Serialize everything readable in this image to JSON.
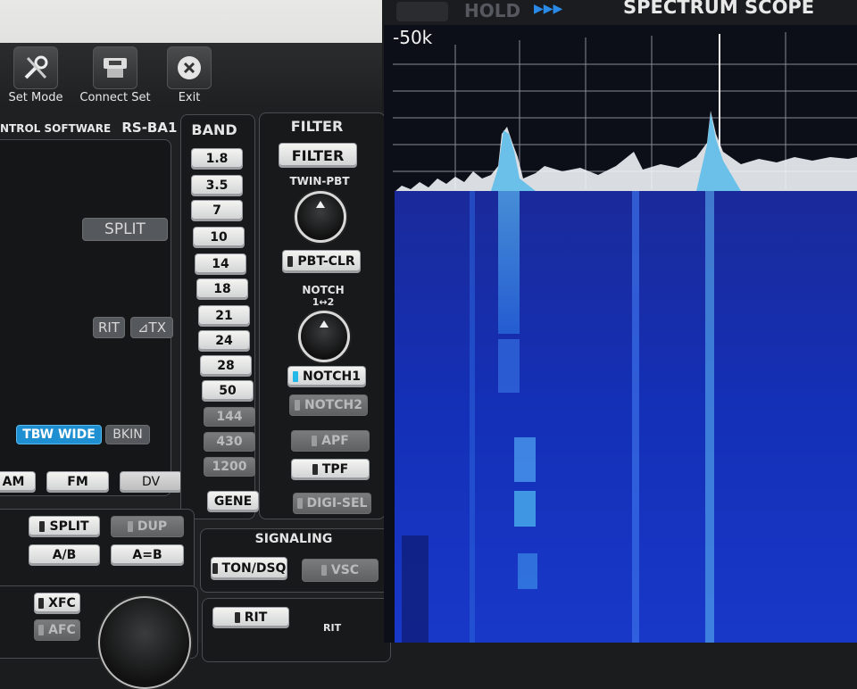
{
  "toolbar": {
    "set_mode": "Set Mode",
    "connect_set": "Connect Set",
    "exit": "Exit"
  },
  "app": {
    "title_left": "NTROL SOFTWARE",
    "title_right": "RS-BA1"
  },
  "display": {
    "split": "SPLIT",
    "rit": "RIT",
    "dtx": "⊿TX",
    "tbw_wide": "TBW WIDE",
    "bkin": "BKIN"
  },
  "modes": [
    "AM",
    "FM",
    "DV"
  ],
  "band": {
    "title": "BAND",
    "items": [
      "1.8",
      "3.5",
      "7",
      "10",
      "14",
      "18",
      "21",
      "24",
      "28",
      "50",
      "144",
      "430",
      "1200",
      "GENE"
    ]
  },
  "filter": {
    "title": "FILTER",
    "filter_btn": "FILTER",
    "twin_pbt": "TWIN-PBT",
    "pbt_clr": "PBT-CLR",
    "notch": "NOTCH",
    "notch_sub": "1↔2",
    "notch1": "NOTCH1",
    "notch2": "NOTCH2",
    "apf": "APF",
    "tpf": "TPF",
    "digisel": "DIGI-SEL"
  },
  "func": {
    "split": "SPLIT",
    "dup": "DUP",
    "ab": "A/B",
    "aeqb": "A=B",
    "xfc": "XFC",
    "afc": "AFC"
  },
  "signaling": {
    "title": "SIGNALING",
    "ton": "TON/DSQ",
    "vsc": "VSC",
    "rit": "RIT",
    "rit_label": "RIT"
  },
  "scope": {
    "title": "SPECTRUM SCOPE",
    "hold": "HOLD",
    "span": "-50k"
  }
}
